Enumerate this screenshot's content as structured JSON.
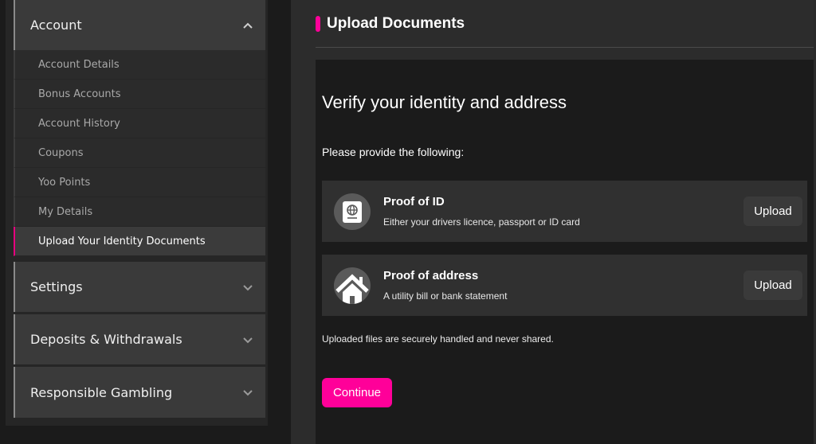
{
  "sidebar": {
    "account": {
      "label": "Account",
      "expanded": true,
      "icon": "chevron-up-icon",
      "items": [
        {
          "label": "Account Details",
          "active": false
        },
        {
          "label": "Bonus Accounts",
          "active": false
        },
        {
          "label": "Account History",
          "active": false
        },
        {
          "label": "Coupons",
          "active": false
        },
        {
          "label": "Yoo Points",
          "active": false
        },
        {
          "label": "My Details",
          "active": false
        },
        {
          "label": "Upload Your Identity Documents",
          "active": true
        }
      ]
    },
    "sections": [
      {
        "label": "Settings",
        "icon": "chevron-down-icon"
      },
      {
        "label": "Deposits & Withdrawals",
        "icon": "chevron-down-icon"
      },
      {
        "label": "Responsible Gambling",
        "icon": "chevron-down-icon"
      }
    ]
  },
  "main": {
    "title": "Upload Documents",
    "card": {
      "heading": "Verify your identity and address",
      "subheading": "Please provide the following:",
      "documents": [
        {
          "title": "Proof of ID",
          "description": "Either your drivers licence, passport or ID card",
          "icon": "passport-icon",
          "button": "Upload"
        },
        {
          "title": "Proof of address",
          "description": "A utility bill or bank statement",
          "icon": "house-icon",
          "button": "Upload"
        }
      ],
      "note": "Uploaded files are securely handled and never shared.",
      "continue_label": "Continue"
    }
  },
  "colors": {
    "accent": "#ff0099",
    "background": "#1b1b1b",
    "panel": "#2c2c2c"
  }
}
